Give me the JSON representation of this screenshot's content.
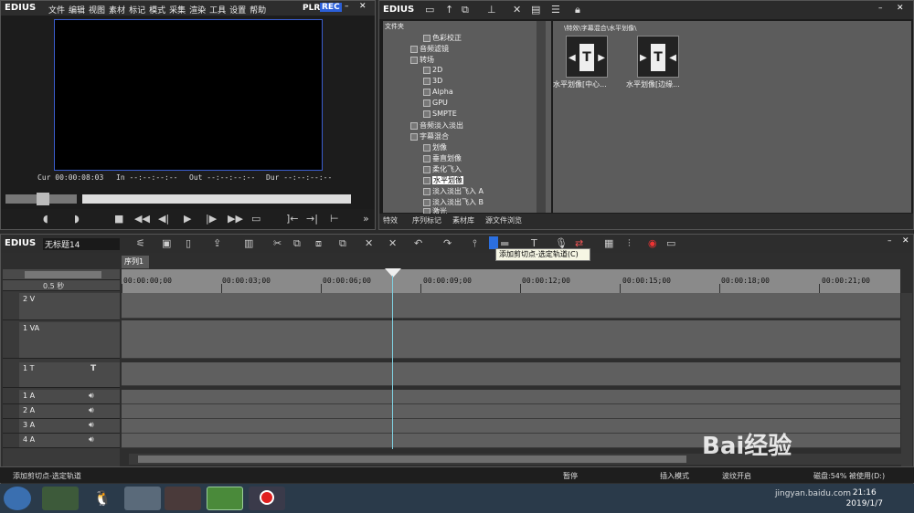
{
  "player": {
    "app": "EDIUS",
    "menu": [
      "文件",
      "编辑",
      "视图",
      "素材",
      "标记",
      "模式",
      "采集",
      "渲染",
      "工具",
      "设置",
      "帮助"
    ],
    "plr": "PLR",
    "rec": "REC",
    "cur_label": "Cur",
    "cur": "00:00:08:03",
    "in_label": "In",
    "in": "--:--:--:--",
    "out_label": "Out",
    "out": "--:--:--:--",
    "dur_label": "Dur",
    "dur": "--:--:--:--"
  },
  "effects": {
    "app": "EDIUS",
    "tree_header": "文件夹",
    "path": "\\特效\\字幕混合\\水平划像\\",
    "tree": [
      "色彩校正",
      "音频滤镜",
      "转场",
      "2D",
      "3D",
      "Alpha",
      "GPU",
      "SMPTE",
      "音频淡入淡出",
      "字幕混合",
      "划像",
      "垂直划像",
      "柔化飞入",
      "水平划像",
      "淡入淡出飞入 A",
      "淡入淡出飞入 B",
      "激光"
    ],
    "selected": "水平划像",
    "thumbs": [
      "水平划像[中心...",
      "水平划像[边缘..."
    ],
    "tabs": [
      "特效",
      "序列标记",
      "素材库",
      "源文件浏览"
    ]
  },
  "timeline": {
    "app": "EDIUS",
    "project": "无标题14",
    "sequence_tab": "序列1",
    "zoom": "0.5 秒",
    "ruler": [
      "00:00:00;00",
      "00:00:03;00",
      "00:00:06;00",
      "00:00:09;00",
      "00:00:12;00",
      "00:00:15;00",
      "00:00:18;00",
      "00:00:21;00"
    ],
    "tracks": [
      "2 V",
      "1 VA",
      "1 T",
      "1 A",
      "2 A",
      "3 A",
      "4 A"
    ],
    "tooltip": "添加剪切点-选定轨道(C)"
  },
  "status": {
    "left": "添加剪切点-选定轨道",
    "mode1": "暂停",
    "mode2": "插入模式",
    "mode3": "波纹开启",
    "disk": "磁盘:54% 被使用(D:)"
  },
  "taskbar": {
    "time": "21:16",
    "date": "2019/1/7"
  },
  "watermark": {
    "brand": "Bai经验",
    "url": "jingyan.baidu.com"
  }
}
